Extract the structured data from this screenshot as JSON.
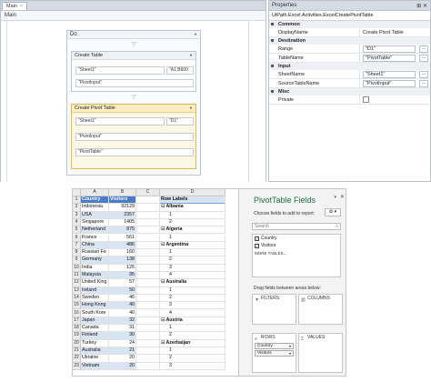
{
  "designer": {
    "tab_label": "Main",
    "tab_close": "×",
    "breadcrumb": "Main",
    "sequence_title": "Do",
    "collapse_glyph": "⯅",
    "activities": [
      {
        "title": "Create Table",
        "sheet": "\"Sheet1\"",
        "range": "\"A1:B600",
        "name": "\"PivotInput\"",
        "extra": ""
      },
      {
        "title": "Create Pivot Table",
        "sheet": "\"Sheet1\"",
        "range": "\"D1\"",
        "name": "\"PivotInput\"",
        "extra": "\"PivotTable\""
      }
    ]
  },
  "properties": {
    "header": "Properties",
    "pin": "⊞ ✕",
    "type_name": "UiPath.Excel.Activities.ExcelCreatePivotTable",
    "groups": [
      {
        "name": "Common",
        "rows": [
          {
            "key": "DisplayName",
            "value": "Create Pivot Table",
            "box": false
          }
        ]
      },
      {
        "name": "Destination",
        "rows": [
          {
            "key": "Range",
            "value": "\"D1\"",
            "box": true
          },
          {
            "key": "TableName",
            "value": "\"PivotTable\"",
            "box": true
          }
        ]
      },
      {
        "name": "Input",
        "rows": [
          {
            "key": "SheetName",
            "value": "\"Sheet1\"",
            "box": true
          },
          {
            "key": "SourceTableName",
            "value": "\"PivotInput\"",
            "box": true
          }
        ]
      },
      {
        "name": "Misc",
        "rows": [
          {
            "key": "Private",
            "value": "",
            "box": false,
            "checkbox": true
          }
        ]
      }
    ],
    "dots": "..."
  },
  "excel": {
    "columns": [
      "",
      "A",
      "B",
      "C",
      "D"
    ],
    "header_country": "Country",
    "header_visitors": "Visitors",
    "pivot_header": "Row Labels",
    "rows": [
      {
        "n": "2",
        "country": "Indonesia",
        "visitors": "92129",
        "pivot": "Albania",
        "bold": true
      },
      {
        "n": "3",
        "country": "USA",
        "visitors": "2357",
        "pivot": "1",
        "bold": false
      },
      {
        "n": "4",
        "country": "Singapore",
        "visitors": "1405",
        "pivot": "2",
        "bold": false
      },
      {
        "n": "5",
        "country": "Netherland",
        "visitors": "875",
        "pivot": "Algeria",
        "bold": true
      },
      {
        "n": "6",
        "country": "France",
        "visitors": "561",
        "pivot": "1",
        "bold": false
      },
      {
        "n": "7",
        "country": "China",
        "visitors": "486",
        "pivot": "Argentina",
        "bold": true
      },
      {
        "n": "8",
        "country": "Russian Fe",
        "visitors": "160",
        "pivot": "1",
        "bold": false
      },
      {
        "n": "9",
        "country": "Germany",
        "visitors": "138",
        "pivot": "2",
        "bold": false
      },
      {
        "n": "10",
        "country": "India",
        "visitors": "125",
        "pivot": "3",
        "bold": false
      },
      {
        "n": "11",
        "country": "Malaysia",
        "visitors": "95",
        "pivot": "4",
        "bold": false
      },
      {
        "n": "12",
        "country": "United King",
        "visitors": "57",
        "pivot": "Australia",
        "bold": true
      },
      {
        "n": "13",
        "country": "Ireland",
        "visitors": "50",
        "pivot": "1",
        "bold": false
      },
      {
        "n": "14",
        "country": "Sweden",
        "visitors": "46",
        "pivot": "2",
        "bold": false
      },
      {
        "n": "15",
        "country": "Hong Kong",
        "visitors": "40",
        "pivot": "3",
        "bold": false
      },
      {
        "n": "16",
        "country": "South Kore",
        "visitors": "40",
        "pivot": "4",
        "bold": false
      },
      {
        "n": "17",
        "country": "Japan",
        "visitors": "32",
        "pivot": "Austria",
        "bold": true
      },
      {
        "n": "18",
        "country": "Canada",
        "visitors": "31",
        "pivot": "1",
        "bold": false
      },
      {
        "n": "19",
        "country": "Finland",
        "visitors": "30",
        "pivot": "2",
        "bold": false
      },
      {
        "n": "20",
        "country": "Turkey",
        "visitors": "24",
        "pivot": "Azerbaijan",
        "bold": true
      },
      {
        "n": "21",
        "country": "Australia",
        "visitors": "21",
        "pivot": "1",
        "bold": false
      },
      {
        "n": "22",
        "country": "Ukraine",
        "visitors": "20",
        "pivot": "2",
        "bold": false
      },
      {
        "n": "23",
        "country": "Vietnam",
        "visitors": "20",
        "pivot": "3",
        "bold": false
      }
    ]
  },
  "field_panel": {
    "title": "PivotTable Fields",
    "subtitle": "Choose fields to add to report:",
    "search_placeholder": "Search",
    "fields": [
      {
        "label": "Country",
        "checked": true
      },
      {
        "label": "Visitors",
        "checked": true
      }
    ],
    "more_tables": "MORE TABLES...",
    "drag_hint": "Drag fields between areas below:",
    "areas": {
      "filters": "FILTERS",
      "columns": "COLUMNS",
      "rows": "ROWS",
      "values": "VALUES"
    },
    "row_fields": [
      "Country",
      "Visitors"
    ],
    "check_glyph": "✓"
  },
  "colors": {
    "excel_green": "#217346",
    "table_header": "#4a7cc7",
    "band": "#d9e4f3",
    "selected_activity": "#fbedc3"
  }
}
